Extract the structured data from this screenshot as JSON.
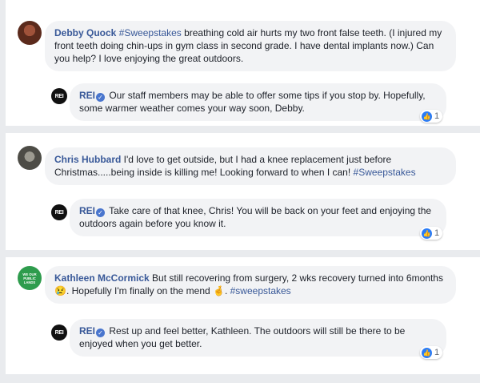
{
  "comments": [
    {
      "author": "Debby Quock",
      "hashtag": "#Sweepstakes",
      "text": " breathing cold air hurts my two front false teeth. (I injured my front teeth doing chin-ups in gym class in second grade. I have dental implants now.) Can you help? I love enjoying the great outdoors.",
      "avatar_color": "#5b2a1c",
      "reply": {
        "author": "REI",
        "text": " Our staff members may be able to offer some tips if you stop by. Hopefully, some warmer weather comes your way soon, Debby.",
        "likes": "1"
      }
    },
    {
      "author": "Chris Hubbard",
      "text_before": " I'd love to get outside, but I had a knee replacement just before Christmas.....being inside is killing me! Looking forward to when I can! ",
      "hashtag": "#Sweepstakes",
      "avatar_color": "#6b6a63",
      "reply": {
        "author": "REI",
        "text": " Take care of that knee, Chris! You will be back on your feet and enjoying the outdoors again before you know it.",
        "likes": "1"
      }
    },
    {
      "author": "Kathleen McCormick",
      "text_before": " But still recovering from surgery, 2 wks recovery turned into 6months ",
      "emoji1": "😢",
      "text_middle": ". Hopefully I'm finally on the mend ",
      "emoji2": "🤞",
      "text_after": ". ",
      "hashtag": "#sweepstakes",
      "avatar_color": "#2e9c4d",
      "avatar_text": "WE OUR PUBLIC LANDS",
      "reply": {
        "author": "REI",
        "text": " Rest up and feel better, Kathleen. The outdoors will still be there to be enjoyed when you get better.",
        "likes": "1"
      }
    }
  ],
  "rei_logo_text": "REI",
  "verified_glyph": "✓",
  "like_glyph": "👍"
}
